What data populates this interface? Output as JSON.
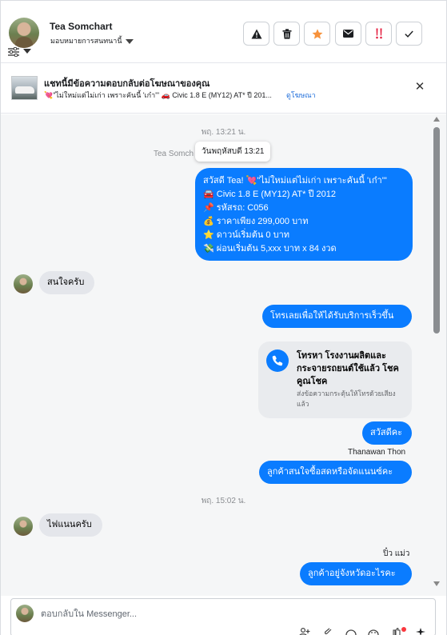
{
  "header": {
    "contact_name": "Tea Somchart",
    "assign_label": "มอบหมายการสนทนานี้",
    "tools": [
      {
        "icon": "warning-icon"
      },
      {
        "icon": "trash-icon"
      },
      {
        "icon": "star-icon",
        "color": "#f7923b"
      },
      {
        "icon": "envelope-icon"
      },
      {
        "icon": "priority-icon",
        "color": "#e41e3f"
      },
      {
        "icon": "check-icon"
      }
    ]
  },
  "ad": {
    "title": "แชทนี้มีข้อความตอบกลับต่อโฆษณาของคุณ",
    "text": "💘\"ไม่ใหม่แต่ไม่เก่า เพราะคันนี้ 'เก๋า'\" 🚗 Civic 1.8 E (MY12) AT* ปี 201...",
    "link": "ดูโฆษณา"
  },
  "thread": {
    "time1": "พฤ. 13:21 น.",
    "sender_faint": "Tea Somch",
    "tooltip": "วันพฤหัสบดี 13:21",
    "ad_reply_lines": [
      "สวัสดี Tea! 💘\"ไม่ใหม่แต่ไม่เก่า เพราะคันนี้ 'เก๋า'\"",
      "🚘  Civic 1.8 E (MY12) AT* ปี 2012",
      "📌 รหัสรถ: C056",
      "💰 ราคาเพียง 299,000 บาท",
      "⭐ ดาวน์เริ่มต้น 0 บาท",
      "💸 ผ่อนเริ่มต้น 5,xxx บาท x 84 งวด"
    ],
    "in_msg1": "สนใจครับ",
    "out_msg1": "โทรเลยเพื่อให้ได้รับบริการเร็วขึ้น",
    "call_card_title": "โทรหา โรงงานผลิตและกระจายรถยนต์ใช้แล้ว โชคคูณโชค",
    "call_card_sub": "ส่งข้อความกระตุ้นให้โทรด้วยเสียงแล้ว",
    "out_msg2": "สวัสดีคะ",
    "agent1": "Thanawan Thon",
    "out_msg3": "ลูกค้าสนใจซื้อสดหรือจัดแนนซ์คะ",
    "time2": "พฤ. 15:02 น.",
    "in_msg2": "ไฟแนนครับ",
    "agent2": "ปิ๋ว แม่ว",
    "out_msg4": "ลูกค้าอยู่จังหวัดอะไรคะ"
  },
  "composer": {
    "placeholder": "ตอบกลับใน Messenger...",
    "value": ""
  }
}
